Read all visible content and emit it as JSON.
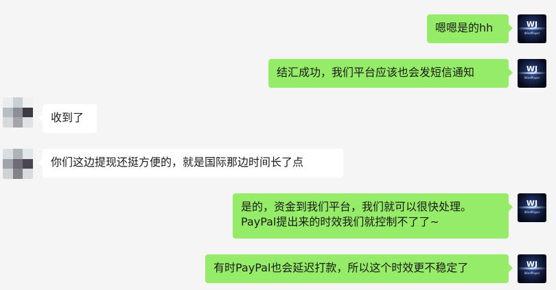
{
  "chat": {
    "self_avatar": {
      "mark": "WJ",
      "brand": "WindPlayer"
    },
    "messages": [
      {
        "from": "self",
        "text": "嗯嗯是的hh"
      },
      {
        "from": "self",
        "text": "结汇成功，我们平台应该也会发短信通知"
      },
      {
        "from": "other",
        "text": "收到了"
      },
      {
        "from": "other",
        "text": "你们这边提现还挺方便的，就是国际那边时间长了点"
      },
      {
        "from": "self",
        "lines": [
          "是的，资金到我们平台，我们就可以很快处理。",
          "PayPal提出来的时效我们就控制不了了~"
        ]
      },
      {
        "from": "self",
        "text": "有时PayPal也会延迟打款，所以这个时效更不稳定了"
      }
    ]
  },
  "colors": {
    "background": "#f5f5f5",
    "bubble_self": "#95ec69",
    "bubble_other": "#ffffff"
  }
}
